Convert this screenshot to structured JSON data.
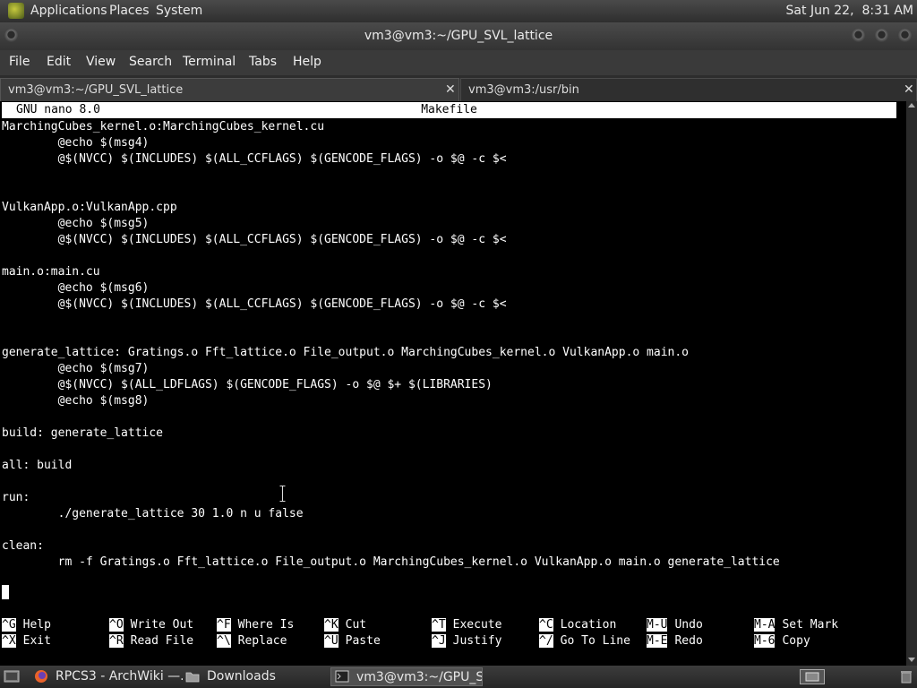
{
  "top_panel": {
    "menus": [
      "Applications",
      "Places",
      "System"
    ],
    "clock": "Sat Jun 22,  8:31 AM"
  },
  "window": {
    "title": "vm3@vm3:~/GPU_SVL_lattice"
  },
  "menubar": [
    "File",
    "Edit",
    "View",
    "Search",
    "Terminal",
    "Tabs",
    "Help"
  ],
  "tabs": [
    {
      "label": "vm3@vm3:~/GPU_SVL_lattice",
      "active": true
    },
    {
      "label": "vm3@vm3:/usr/bin",
      "active": false
    }
  ],
  "nano": {
    "version": "GNU nano 8.0",
    "filename": "Makefile",
    "lines": [
      "MarchingCubes_kernel.o:MarchingCubes_kernel.cu",
      "        @echo $(msg4)",
      "        @$(NVCC) $(INCLUDES) $(ALL_CCFLAGS) $(GENCODE_FLAGS) -o $@ -c $<",
      "",
      "",
      "VulkanApp.o:VulkanApp.cpp",
      "        @echo $(msg5)",
      "        @$(NVCC) $(INCLUDES) $(ALL_CCFLAGS) $(GENCODE_FLAGS) -o $@ -c $<",
      "",
      "main.o:main.cu",
      "        @echo $(msg6)",
      "        @$(NVCC) $(INCLUDES) $(ALL_CCFLAGS) $(GENCODE_FLAGS) -o $@ -c $<",
      "",
      "",
      "generate_lattice: Gratings.o Fft_lattice.o File_output.o MarchingCubes_kernel.o VulkanApp.o main.o",
      "        @echo $(msg7)",
      "        @$(NVCC) $(ALL_LDFLAGS) $(GENCODE_FLAGS) -o $@ $+ $(LIBRARIES)",
      "        @echo $(msg8)",
      "",
      "build: generate_lattice",
      "",
      "all: build",
      "",
      "run:",
      "        ./generate_lattice 30 1.0 n u false",
      "",
      "clean:",
      "        rm -f Gratings.o Fft_lattice.o File_output.o MarchingCubes_kernel.o VulkanApp.o main.o generate_lattice"
    ],
    "shortcuts_row1": [
      {
        "key": "^G",
        "label": "Help"
      },
      {
        "key": "^O",
        "label": "Write Out"
      },
      {
        "key": "^F",
        "label": "Where Is"
      },
      {
        "key": "^K",
        "label": "Cut"
      },
      {
        "key": "^T",
        "label": "Execute"
      },
      {
        "key": "^C",
        "label": "Location"
      },
      {
        "key": "M-U",
        "label": "Undo"
      },
      {
        "key": "M-A",
        "label": "Set Mark"
      }
    ],
    "shortcuts_row2": [
      {
        "key": "^X",
        "label": "Exit"
      },
      {
        "key": "^R",
        "label": "Read File"
      },
      {
        "key": "^\\",
        "label": "Replace"
      },
      {
        "key": "^U",
        "label": "Paste"
      },
      {
        "key": "^J",
        "label": "Justify"
      },
      {
        "key": "^/",
        "label": "Go To Line"
      },
      {
        "key": "M-E",
        "label": "Redo"
      },
      {
        "key": "M-6",
        "label": "Copy"
      }
    ]
  },
  "taskbar": [
    {
      "label": "RPCS3 - ArchWiki —...",
      "icon": "firefox-icon"
    },
    {
      "label": "Downloads",
      "icon": "folder-icon"
    },
    {
      "label": "vm3@vm3:~/GPU_S...",
      "icon": "terminal-icon"
    }
  ]
}
